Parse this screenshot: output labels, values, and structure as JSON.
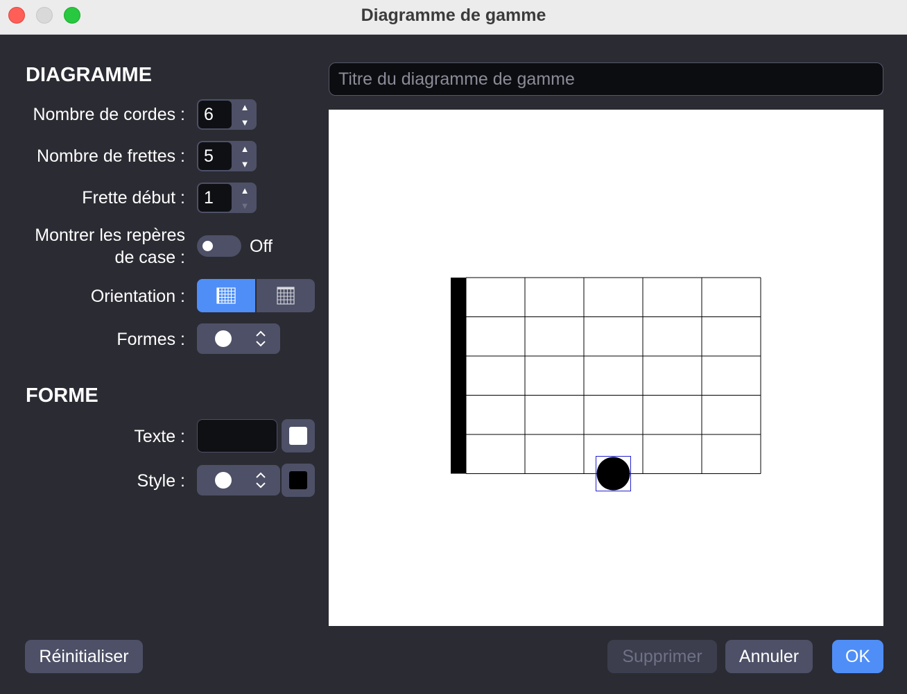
{
  "window": {
    "title": "Diagramme de gamme"
  },
  "diagram_section": {
    "heading": "DIAGRAMME",
    "strings_label": "Nombre de cordes :",
    "strings_value": "6",
    "frets_label": "Nombre de frettes :",
    "frets_value": "5",
    "start_fret_label": "Frette début :",
    "start_fret_value": "1",
    "markers_label_line1": "Montrer les repères",
    "markers_label_line2": "de case :",
    "markers_state": "Off",
    "orientation_label": "Orientation :",
    "orientation_selected": "horizontal",
    "shapes_label": "Formes :",
    "shapes_selected": "circle"
  },
  "shape_section": {
    "heading": "FORME",
    "text_label": "Texte :",
    "text_value": "",
    "text_color": "#ffffff",
    "style_label": "Style :",
    "style_shape": "circle",
    "style_color": "#000000"
  },
  "diagram_title": {
    "value": "",
    "placeholder": "Titre du diagramme de gamme"
  },
  "diagram": {
    "strings": 6,
    "frets": 5,
    "start_fret": 1,
    "dots": [
      {
        "string": 6,
        "fret": 3,
        "shape": "circle",
        "color": "#000000",
        "selected": true
      }
    ]
  },
  "buttons": {
    "reset": "Réinitialiser",
    "delete": "Supprimer",
    "cancel": "Annuler",
    "ok": "OK"
  },
  "colors": {
    "accent": "#4f8ef7",
    "background": "#2b2b33",
    "control": "#4d5066"
  }
}
